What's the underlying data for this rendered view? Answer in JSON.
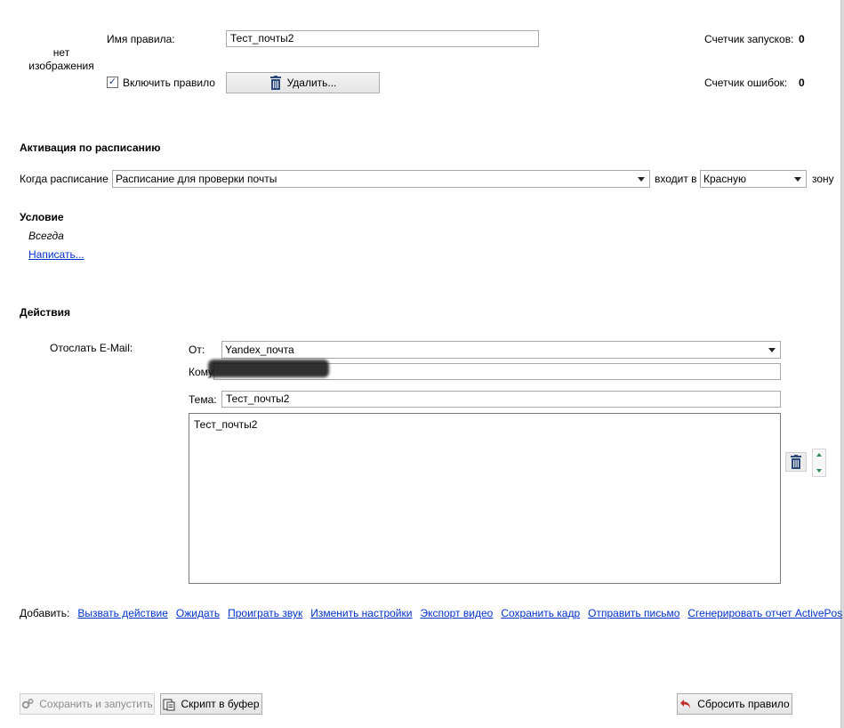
{
  "header": {
    "no_image_line1": "нет",
    "no_image_line2": "изображения",
    "rule_name_label": "Имя правила:",
    "rule_name_value": "Тест_почты2",
    "enable_rule_label": "Включить правило",
    "enable_rule_checked": true,
    "delete_button": "Удалить...",
    "run_counter_label": "Счетчик запусков:",
    "run_counter_value": "0",
    "error_counter_label": "Счетчик ошибок:",
    "error_counter_value": "0"
  },
  "schedule": {
    "section_title": "Активация по расписанию",
    "when_label": "Когда расписание",
    "schedule_value": "Расписание для проверки почты",
    "enters_label": "входит в",
    "zone_value": "Красную",
    "zone_suffix": "зону"
  },
  "condition": {
    "section_title": "Условие",
    "value": "Всегда",
    "write_link": "Написать..."
  },
  "actions": {
    "section_title": "Действия",
    "send_email_label": "Отослать E-Mail:",
    "from_label": "От:",
    "from_value": "Yandex_почта",
    "to_label": "Кому:",
    "subject_label": "Тема:",
    "subject_value": "Тест_почты2",
    "body_value": "Тест_почты2"
  },
  "add_actions": {
    "label": "Добавить:",
    "links": [
      "Вызвать действие",
      "Ожидать",
      "Проиграть звук",
      "Изменить настройки",
      "Экспорт видео",
      "Сохранить кадр",
      "Отправить письмо",
      "Сгенерировать отчет ActivePos"
    ]
  },
  "footer": {
    "save_run_button": "Сохранить и запустить",
    "script_button": "Скрипт в буфер",
    "reset_button": "Сбросить правило"
  }
}
